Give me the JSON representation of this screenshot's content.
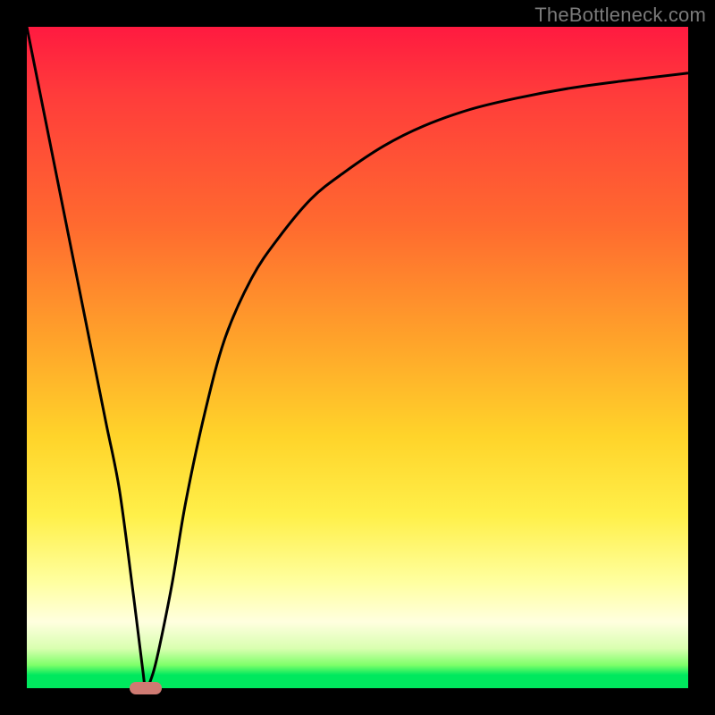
{
  "watermark": "TheBottleneck.com",
  "chart_data": {
    "type": "line",
    "title": "",
    "xlabel": "",
    "ylabel": "",
    "xlim": [
      0,
      100
    ],
    "ylim": [
      0,
      100
    ],
    "grid": false,
    "legend": false,
    "series": [
      {
        "name": "bottleneck-curve",
        "x": [
          0,
          2,
          4,
          6,
          8,
          10,
          12,
          14,
          16,
          17.5,
          18,
          19,
          20,
          22,
          24,
          27,
          30,
          34,
          38,
          43,
          48,
          54,
          60,
          67,
          74,
          82,
          90,
          100
        ],
        "y": [
          100,
          90,
          80,
          70,
          60,
          50,
          40,
          30,
          15,
          3,
          0,
          2,
          6,
          16,
          28,
          42,
          53,
          62,
          68,
          74,
          78,
          82,
          85,
          87.5,
          89.2,
          90.7,
          91.8,
          93
        ]
      }
    ],
    "annotations": [
      {
        "name": "minimum-marker",
        "x": 18,
        "y": 0
      }
    ],
    "colors": {
      "curve": "#000000",
      "marker": "#cf7a72",
      "gradient_top": "#ff1a40",
      "gradient_mid": "#ffd42a",
      "gradient_bottom": "#00e85e"
    }
  }
}
